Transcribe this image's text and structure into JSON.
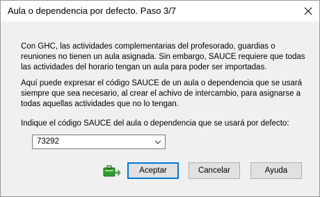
{
  "window": {
    "title": "Aula o dependencia por defecto. Paso 3/7"
  },
  "content": {
    "paragraph1": "Con GHC, las actividades complementarias del profesorado, guardias o reuniones no tienen un aula asignada. Sin embargo, SAUCE requiere que todas las actividades del horario tengan un aula para poder ser importadas.",
    "paragraph2": "Aquí puede expresar el código SAUCE de un aula o dependencia que se usará siempre que sea necesario, al crear el achivo de intercambio, para asignarse a todas aquellas actividades que no lo tengan.",
    "prompt": "Indique el código SAUCE del aula o dependencia que se usará por defecto:",
    "classroom_code": "73292"
  },
  "buttons": {
    "accept": "Aceptar",
    "cancel": "Cancelar",
    "help": "Ayuda"
  },
  "icons": {
    "close": "close-icon",
    "dropdown": "chevron-down-icon",
    "accept_icon": "briefcase-arrow-icon"
  },
  "colors": {
    "focus_border": "#0078d7",
    "icon_green": "#2e9e2e"
  }
}
